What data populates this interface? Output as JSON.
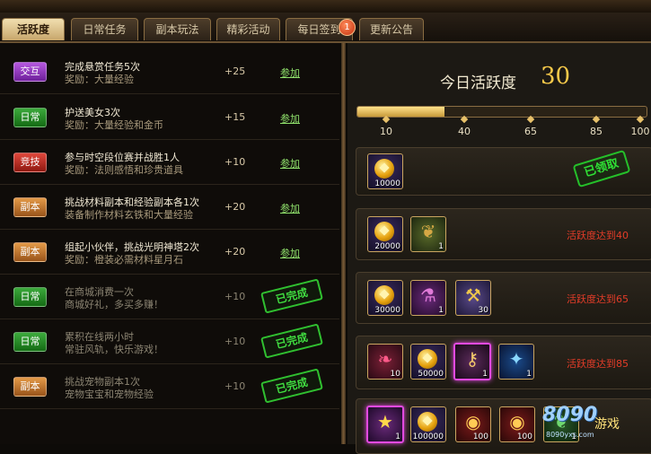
{
  "tabs": [
    {
      "label": "活跃度"
    },
    {
      "label": "日常任务"
    },
    {
      "label": "副本玩法"
    },
    {
      "label": "精彩活动"
    },
    {
      "label": "每日签到"
    },
    {
      "label": "更新公告"
    }
  ],
  "active_tab": "活跃度",
  "signin_badge": "1",
  "tasks": [
    {
      "tag": "交互",
      "tag_color": "#a23fd0",
      "name": "完成悬赏任务5次",
      "reward": "奖励：大量经验",
      "points": "+25",
      "action": "参加",
      "status": "open"
    },
    {
      "tag": "日常",
      "tag_color": "#2a9a2a",
      "name": "护送美女3次",
      "reward": "奖励：大量经验和金币",
      "points": "+15",
      "action": "参加",
      "status": "open"
    },
    {
      "tag": "竞技",
      "tag_color": "#c8302a",
      "name": "参与时空段位赛并战胜1人",
      "reward": "奖励：法则感悟和珍贵道具",
      "points": "+10",
      "action": "参加",
      "status": "open"
    },
    {
      "tag": "副本",
      "tag_color": "#d08a3a",
      "name": "挑战材料副本和经验副本各1次",
      "reward": "装备制作材料玄铁和大量经验",
      "points": "+20",
      "action": "参加",
      "status": "open"
    },
    {
      "tag": "副本",
      "tag_color": "#d08a3a",
      "name": "组起小伙伴，挑战光明神塔2次",
      "reward": "奖励：橙装必需材料星月石",
      "points": "+20",
      "action": "参加",
      "status": "open"
    },
    {
      "tag": "日常",
      "tag_color": "#2a9a2a",
      "name": "在商城消费一次",
      "reward": "商城好礼，多买多赚！",
      "points": "+10",
      "action": "已完成",
      "status": "done"
    },
    {
      "tag": "日常",
      "tag_color": "#2a9a2a",
      "name": "累积在线两小时",
      "reward": "常驻风轨，快乐游戏！",
      "points": "+10",
      "action": "已完成",
      "status": "done"
    },
    {
      "tag": "副本",
      "tag_color": "#d08a3a",
      "name": "挑战宠物副本1次",
      "reward": "宠物宝宝和宠物经验",
      "points": "+10",
      "action": "已完成",
      "status": "done"
    }
  ],
  "activity": {
    "title": "今日活跃度",
    "value": "30",
    "progress_fraction": 0.3
  },
  "milestones": [
    "10",
    "40",
    "65",
    "85",
    "100"
  ],
  "rewards": [
    {
      "items": [
        {
          "icon": "gold-coin",
          "qty": "10000"
        }
      ],
      "status_text": "已领取",
      "claimed": true
    },
    {
      "items": [
        {
          "icon": "gold-coin",
          "qty": "20000"
        },
        {
          "icon": "leaf-scroll",
          "qty": "1"
        }
      ],
      "status_text": "活跃度达到40",
      "claimed": false
    },
    {
      "items": [
        {
          "icon": "gold-coin",
          "qty": "30000"
        },
        {
          "icon": "potion",
          "qty": "1"
        },
        {
          "icon": "hammer-stone",
          "qty": "30"
        }
      ],
      "status_text": "活跃度达到65",
      "claimed": false
    },
    {
      "items": [
        {
          "icon": "red-wings",
          "qty": "10"
        },
        {
          "icon": "gold-coin",
          "qty": "50000"
        },
        {
          "icon": "key-tool",
          "qty": "1"
        },
        {
          "icon": "blue-crystal",
          "qty": "1"
        }
      ],
      "status_text": "活跃度达到85",
      "claimed": false
    },
    {
      "items": [
        {
          "icon": "star-box",
          "qty": "1"
        },
        {
          "icon": "gold-coin",
          "qty": "100000"
        },
        {
          "icon": "red-token",
          "qty": "100"
        },
        {
          "icon": "red-token",
          "qty": "100"
        },
        {
          "icon": "leaf",
          "qty": "1"
        }
      ],
      "status_text": "",
      "claimed": false
    }
  ],
  "watermark": {
    "main": "8090",
    "sub": "游戏",
    "url": "8090yxs.com"
  }
}
